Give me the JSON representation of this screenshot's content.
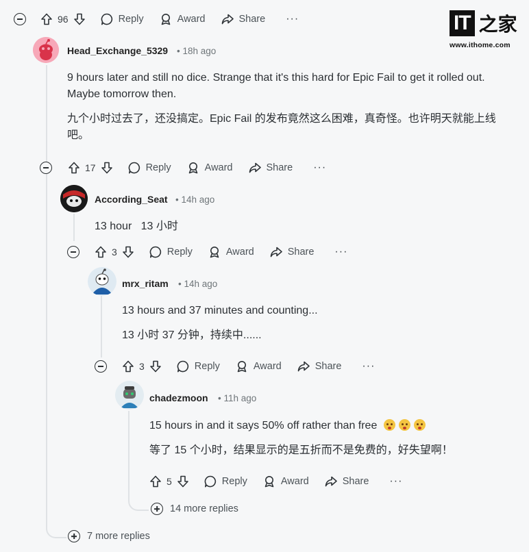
{
  "top_actions": {
    "count": "96",
    "reply": "Reply",
    "award": "Award",
    "share": "Share",
    "more": "···"
  },
  "comments": [
    {
      "author": "Head_Exchange_5329",
      "time": "• 18h ago",
      "body_en": "9 hours later and still no dice. Strange that it's this hard for Epic Fail to get it rolled out. Maybe tomorrow then.",
      "body_zh": "九个小时过去了，还没搞定。Epic Fail 的发布竟然这么困难，真奇怪。也许明天就能上线吧。",
      "votes": "17",
      "reply": "Reply",
      "award": "Award",
      "share": "Share",
      "more": "···"
    },
    {
      "author": "According_Seat",
      "time": "• 14h ago",
      "body": "13 hour   13 小时",
      "votes": "3",
      "reply": "Reply",
      "award": "Award",
      "share": "Share",
      "more": "···"
    },
    {
      "author": "mrx_ritam",
      "time": "• 14h ago",
      "body_en": "13 hours and 37 minutes and counting...",
      "body_zh": "13 小时 37 分钟，持续中......",
      "votes": "3",
      "reply": "Reply",
      "award": "Award",
      "share": "Share",
      "more": "···"
    },
    {
      "author": "chadezmoon",
      "time": "• 11h ago",
      "body_en": "15 hours in and it says 50% off rather than free",
      "body_zh": "等了 15 个小时，结果显示的是五折而不是免费的，好失望啊！",
      "votes": "5",
      "reply": "Reply",
      "award": "Award",
      "share": "Share",
      "more": "···"
    }
  ],
  "more_replies_inner": "14 more replies",
  "more_replies_outer": "7 more replies",
  "watermark": {
    "mark": "IT",
    "zh": "之家",
    "url": "www.ithome.com"
  }
}
